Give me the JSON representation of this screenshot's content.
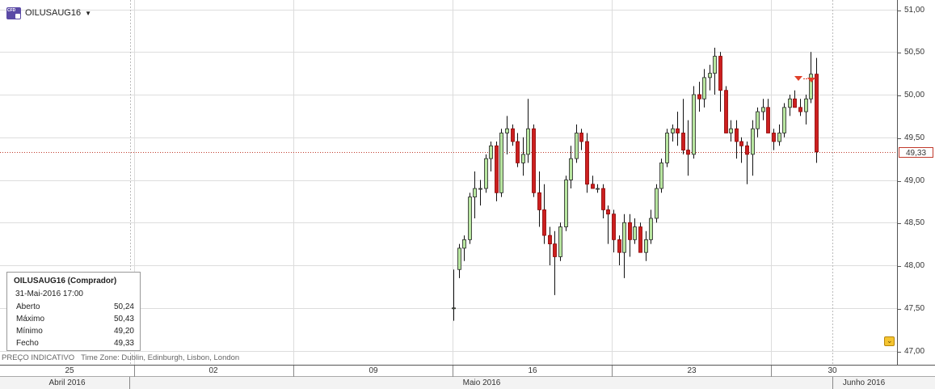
{
  "instrument": {
    "name": "OILUSAUG16",
    "icon": "cfd-icon",
    "icon_text": "CFD"
  },
  "info_box": {
    "title": "OILUSAUG16 (Comprador)",
    "date": "31-Mai-2016 17:00",
    "rows": [
      {
        "label": "Aberto",
        "value": "50,24"
      },
      {
        "label": "Máximo",
        "value": "50,43"
      },
      {
        "label": "Mínimo",
        "value": "49,20"
      },
      {
        "label": "Fecho",
        "value": "49,33"
      }
    ]
  },
  "footer": {
    "indicative": "PREÇO INDICATIVO",
    "timezone": "Time Zone: Dublin, Edinburgh, Lisbon, London"
  },
  "price_tag": "49,33",
  "x_axis": {
    "day_labels": [
      "25",
      "02",
      "09",
      "16",
      "23",
      "30"
    ],
    "month_labels": [
      "Abril 2016",
      "Maio 2016",
      "Junho 2016"
    ]
  },
  "colors": {
    "up": "#b8e6a0",
    "down": "#cc1f1f",
    "grid": "#dddddd",
    "price_line": "#c0392b",
    "marker": "#e0402a"
  },
  "chart_data": {
    "type": "candlestick",
    "ylim": [
      46.9,
      51.05
    ],
    "yticks": [
      "51,00",
      "50,50",
      "50,00",
      "49,50",
      "49,00",
      "48,50",
      "48,00",
      "47,50",
      "47,00"
    ],
    "ytick_values": [
      51.0,
      50.5,
      50.0,
      49.5,
      49.0,
      48.5,
      48.0,
      47.5,
      47.0
    ],
    "last_price": 49.33,
    "candles": [
      [
        47.5,
        47.95,
        47.35,
        47.5
      ],
      [
        47.95,
        48.25,
        47.85,
        48.2
      ],
      [
        48.2,
        48.35,
        48.05,
        48.3
      ],
      [
        48.3,
        48.85,
        48.25,
        48.8
      ],
      [
        48.8,
        49.1,
        48.55,
        48.9
      ],
      [
        48.9,
        49.0,
        48.7,
        48.9
      ],
      [
        48.9,
        49.3,
        48.85,
        49.25
      ],
      [
        49.25,
        49.45,
        49.1,
        49.4
      ],
      [
        49.4,
        49.45,
        48.75,
        48.85
      ],
      [
        48.85,
        49.6,
        48.8,
        49.55
      ],
      [
        49.55,
        49.75,
        49.3,
        49.6
      ],
      [
        49.6,
        49.65,
        49.4,
        49.45
      ],
      [
        49.45,
        49.55,
        49.15,
        49.2
      ],
      [
        49.2,
        49.5,
        49.05,
        49.3
      ],
      [
        49.3,
        49.95,
        49.2,
        49.6
      ],
      [
        49.6,
        49.65,
        48.8,
        48.85
      ],
      [
        48.85,
        49.1,
        48.45,
        48.65
      ],
      [
        48.65,
        48.95,
        48.25,
        48.35
      ],
      [
        48.35,
        48.45,
        48.0,
        48.25
      ],
      [
        48.25,
        48.4,
        47.65,
        48.1
      ],
      [
        48.1,
        48.5,
        48.05,
        48.45
      ],
      [
        48.45,
        49.05,
        48.4,
        49.0
      ],
      [
        49.0,
        49.4,
        48.9,
        49.25
      ],
      [
        49.25,
        49.65,
        49.2,
        49.55
      ],
      [
        49.55,
        49.6,
        49.35,
        49.45
      ],
      [
        49.45,
        49.55,
        48.85,
        48.95
      ],
      [
        48.95,
        49.05,
        48.9,
        48.9
      ],
      [
        48.9,
        48.95,
        48.85,
        48.9
      ],
      [
        48.9,
        48.95,
        48.55,
        48.65
      ],
      [
        48.65,
        48.7,
        48.25,
        48.6
      ],
      [
        48.6,
        48.65,
        48.15,
        48.3
      ],
      [
        48.3,
        48.35,
        48.0,
        48.15
      ],
      [
        48.15,
        48.6,
        47.85,
        48.5
      ],
      [
        48.5,
        48.6,
        48.1,
        48.3
      ],
      [
        48.3,
        48.55,
        48.25,
        48.45
      ],
      [
        48.45,
        48.5,
        48.15,
        48.15
      ],
      [
        48.15,
        48.4,
        48.05,
        48.3
      ],
      [
        48.3,
        48.65,
        48.25,
        48.55
      ],
      [
        48.55,
        48.95,
        48.5,
        48.9
      ],
      [
        48.9,
        49.25,
        48.85,
        49.2
      ],
      [
        49.2,
        49.6,
        49.15,
        49.55
      ],
      [
        49.55,
        49.65,
        49.45,
        49.6
      ],
      [
        49.6,
        49.8,
        49.4,
        49.55
      ],
      [
        49.55,
        49.95,
        49.3,
        49.35
      ],
      [
        49.35,
        49.7,
        49.05,
        49.3
      ],
      [
        49.3,
        50.1,
        49.25,
        50.0
      ],
      [
        50.0,
        50.15,
        49.8,
        49.95
      ],
      [
        49.95,
        50.3,
        49.85,
        50.2
      ],
      [
        50.2,
        50.35,
        50.05,
        50.25
      ],
      [
        50.25,
        50.55,
        50.0,
        50.45
      ],
      [
        50.45,
        50.5,
        49.8,
        50.05
      ],
      [
        50.05,
        50.1,
        49.55,
        49.55
      ],
      [
        49.55,
        49.7,
        49.45,
        49.6
      ],
      [
        49.6,
        49.7,
        49.25,
        49.45
      ],
      [
        49.45,
        49.5,
        49.2,
        49.4
      ],
      [
        49.4,
        49.45,
        48.95,
        49.3
      ],
      [
        49.3,
        49.7,
        49.05,
        49.6
      ],
      [
        49.6,
        49.85,
        49.5,
        49.8
      ],
      [
        49.8,
        49.95,
        49.7,
        49.85
      ],
      [
        49.85,
        49.95,
        49.55,
        49.55
      ],
      [
        49.55,
        49.6,
        49.35,
        49.45
      ],
      [
        49.45,
        49.65,
        49.4,
        49.55
      ],
      [
        49.55,
        49.9,
        49.5,
        49.85
      ],
      [
        49.85,
        50.0,
        49.75,
        49.95
      ],
      [
        49.95,
        50.05,
        49.85,
        49.85
      ],
      [
        49.85,
        49.95,
        49.75,
        49.8
      ],
      [
        49.8,
        50.0,
        49.65,
        49.95
      ],
      [
        49.95,
        50.5,
        49.9,
        50.24
      ],
      [
        50.24,
        50.43,
        49.2,
        49.33
      ]
    ]
  }
}
